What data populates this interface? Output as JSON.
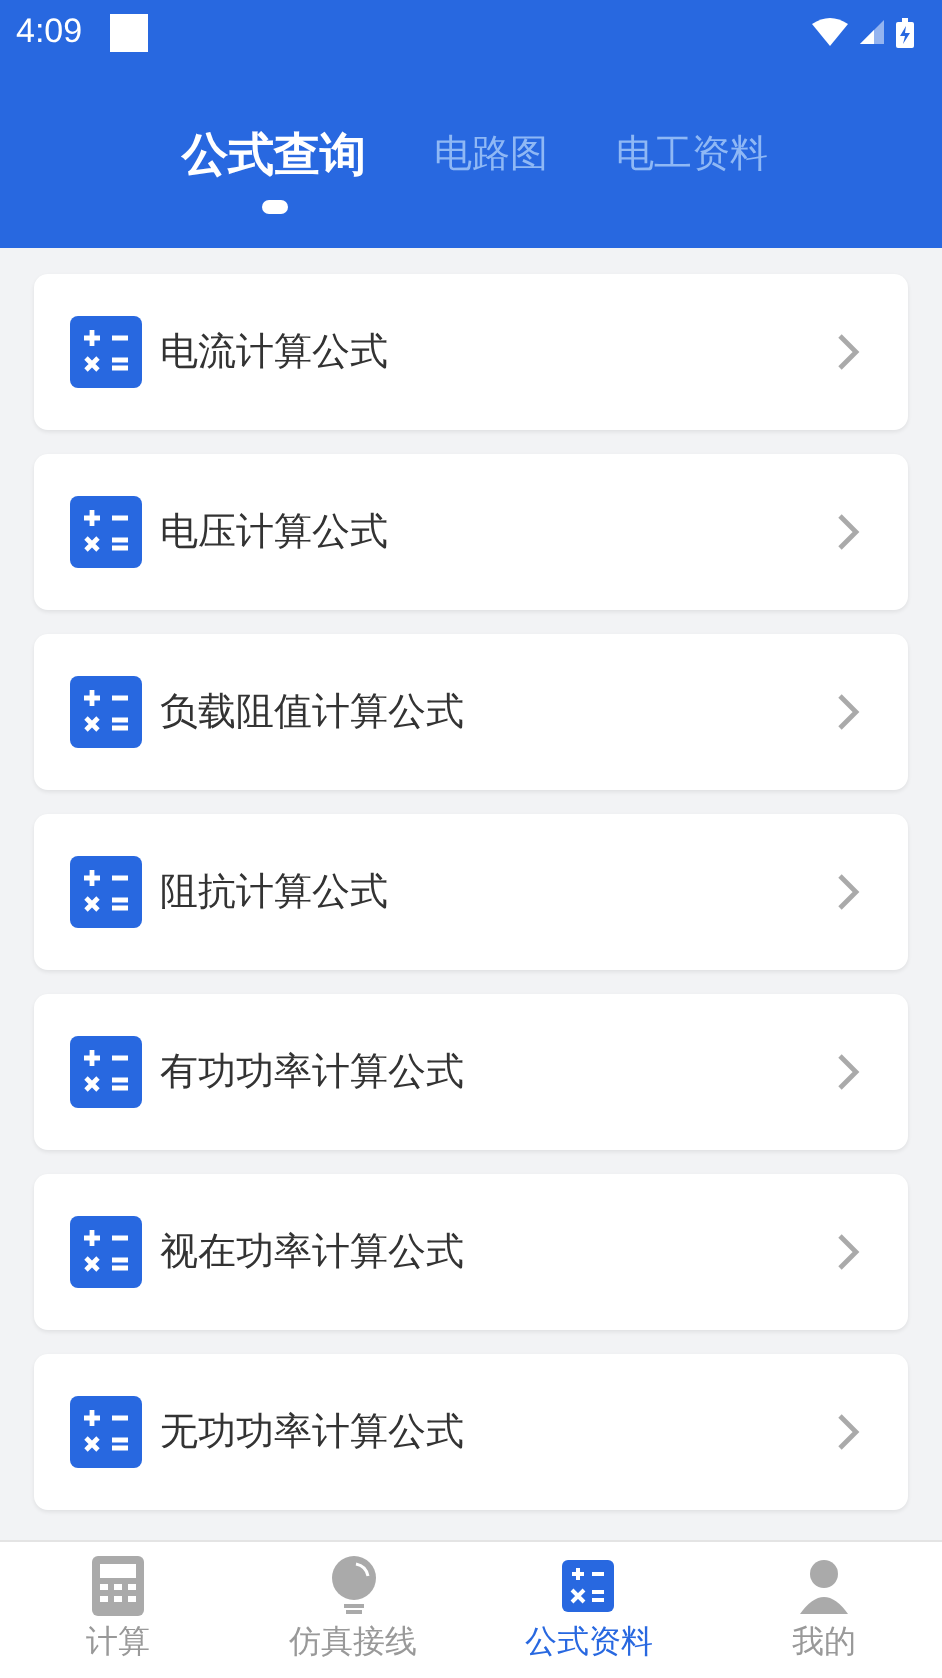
{
  "status_bar": {
    "time": "4:09"
  },
  "top_tabs": [
    {
      "label": "公式查询",
      "selected": true
    },
    {
      "label": "电路图",
      "selected": false
    },
    {
      "label": "电工资料",
      "selected": false
    }
  ],
  "formulas": [
    {
      "label": "电流计算公式"
    },
    {
      "label": "电压计算公式"
    },
    {
      "label": "负载阻值计算公式"
    },
    {
      "label": "阻抗计算公式"
    },
    {
      "label": "有功功率计算公式"
    },
    {
      "label": "视在功率计算公式"
    },
    {
      "label": "无功功率计算公式"
    }
  ],
  "bottom_nav": [
    {
      "label": "计算",
      "kind": "calculator",
      "selected": false
    },
    {
      "label": "仿真接线",
      "kind": "bulb",
      "selected": false
    },
    {
      "label": "公式资料",
      "kind": "formula",
      "selected": true
    },
    {
      "label": "我的",
      "kind": "person",
      "selected": false
    }
  ]
}
